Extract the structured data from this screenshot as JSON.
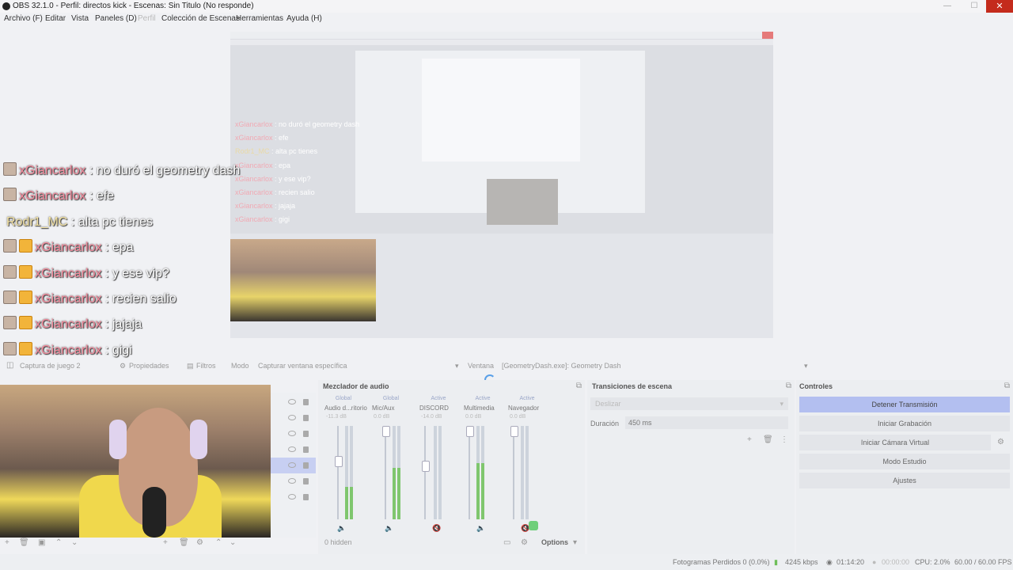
{
  "window": {
    "title": "OBS 32.1.0 - Perfil: directos kick - Escenas: Sin Titulo (No responde)",
    "minimize": "—",
    "maximize": "☐",
    "close": "✕"
  },
  "menu": [
    "Archivo (F)",
    "Editar",
    "Vista",
    "Paneles (D)",
    "Perfil",
    "Colección de Escenas",
    "Herramientas",
    "Ayuda (H)"
  ],
  "chat": [
    {
      "user": "xGiancarlox",
      "message": ": no duró el geometry dash",
      "badge": "mod"
    },
    {
      "user": "xGiancarlox",
      "message": ": efe",
      "badge": "mod"
    },
    {
      "user": "Rodr1_MC",
      "message": ": alta pc tienes",
      "badge": "none"
    },
    {
      "user": "xGiancarlox",
      "message": ": epa",
      "badge": "mod+crown"
    },
    {
      "user": "xGiancarlox",
      "message": ": y ese vip?",
      "badge": "mod+crown"
    },
    {
      "user": "xGiancarlox",
      "message": ": recien salio",
      "badge": "mod+crown"
    },
    {
      "user": "xGiancarlox",
      "message": ": jajaja",
      "badge": "mod+crown"
    },
    {
      "user": "xGiancarlox",
      "message": ": gigi",
      "badge": "mod+crown"
    }
  ],
  "source_toolbar": {
    "source_name": "Captura de juego 2",
    "properties": "Propiedades",
    "filters": "Filtros",
    "mode_label": "Modo",
    "mode_value": "Capturar ventana específica",
    "window_label": "Ventana",
    "window_value": "[GeometryDash.exe]: Geometry Dash"
  },
  "mixer": {
    "title": "Mezclador de audio",
    "channels": [
      {
        "group": "Global",
        "name": "Audio d...ritorio",
        "db": "-11.3 dB",
        "level": 0.35
      },
      {
        "group": "Global",
        "name": "Mic/Aux",
        "db": "0.0 dB",
        "level": 0.55
      },
      {
        "group": "Active",
        "name": "DISCORD",
        "db": "-14.0 dB",
        "level": 0.0
      },
      {
        "group": "Active",
        "name": "Multimedia",
        "db": "0.0 dB",
        "level": 0.6
      },
      {
        "group": "Active",
        "name": "Navegador",
        "db": "0.0 dB",
        "level": 0.0
      }
    ],
    "hidden": "0 hidden",
    "options": "Options"
  },
  "transitions": {
    "title": "Transiciones de escena",
    "transition": "Deslizar",
    "duration_label": "Duración",
    "duration_value": "450 ms"
  },
  "controls": {
    "title": "Controles",
    "stop_stream": "Detener Transmisión",
    "start_recording": "Iniciar Grabación",
    "virtual_cam": "Iniciar Cámara Virtual",
    "studio_mode": "Modo Estudio",
    "settings": "Ajustes"
  },
  "status": {
    "dropped": "Fotogramas Perdidos 0 (0.0%)",
    "bitrate": "4245 kbps",
    "stream_time": "01:14:20",
    "rec_time": "00:00:00",
    "cpu": "CPU: 2.0%",
    "fps": "60.00 / 60.00 FPS"
  },
  "colors": {
    "accent": "#b3bff0",
    "close_red": "#c42b1c",
    "meter_green": "#7fc66e"
  }
}
